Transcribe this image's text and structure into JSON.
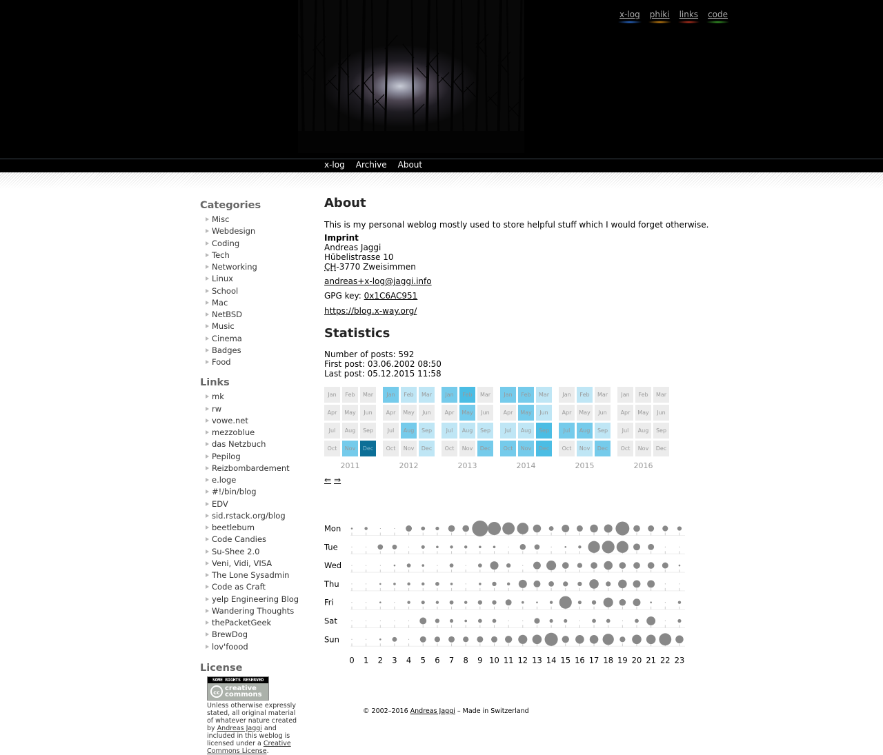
{
  "top_nav": [
    {
      "label": "x-log",
      "color": "#2b6fd6"
    },
    {
      "label": "phiki",
      "color": "#d78a12"
    },
    {
      "label": "links",
      "color": "#c23420"
    },
    {
      "label": "code",
      "color": "#3aa12a"
    }
  ],
  "main_nav": [
    "x-log",
    "Archive",
    "About"
  ],
  "sidebar": {
    "categories_title": "Categories",
    "categories": [
      "Misc",
      "Webdesign",
      "Coding",
      "Tech",
      "Networking",
      "Linux",
      "School",
      "Mac",
      "NetBSD",
      "Music",
      "Cinema",
      "Badges",
      "Food"
    ],
    "links_title": "Links",
    "links": [
      "mk",
      "rw",
      "vowe.net",
      "mezzoblue",
      "das Netzbuch",
      "Pepilog",
      "Reizbombardement",
      "e.loge",
      "#!/bin/blog",
      "EDV",
      "sid.rstack.org/blog",
      "beetlebum",
      "Code Candies",
      "Su-Shee 2.0",
      "Veni, Vidi, VISA",
      "The Lone Sysadmin",
      "Code as Craft",
      "yelp Engineering Blog",
      "Wandering Thoughts",
      "thePacketGeek",
      "BrewDog",
      "lov'foood"
    ],
    "license_title": "License",
    "license_badge_top": "SOME RIGHTS RESERVED",
    "license_badge_word1": "creative",
    "license_badge_word2": "commons",
    "license_text_1": "Unless otherwise expressly stated, all original material of whatever nature created by ",
    "license_author": "Andreas Jaggi",
    "license_text_2": " and included in this weblog is licensed under a ",
    "license_link": "Creative Commons License",
    "license_text_3": "."
  },
  "about": {
    "title": "About",
    "intro": "This is my personal weblog mostly used to store helpful stuff which I would forget otherwise.",
    "imprint_label": "Imprint",
    "name": "Andreas Jaggi",
    "street": "Hübelistrasse 10",
    "country": "CH",
    "city": "-3770 Zweisimmen",
    "email": "andreas+x-log@jaggi.info",
    "gpg_label": "GPG key: ",
    "gpg_key": "0x1C6AC951",
    "url": "https://blog.x-way.org/"
  },
  "statistics": {
    "title": "Statistics",
    "posts": "Number of posts: 592",
    "first": "First post: 03.06.2002 08:50",
    "last": "Last post: 05.12.2015 11:58"
  },
  "calendar": {
    "months": [
      "Jan",
      "Feb",
      "Mar",
      "Apr",
      "May",
      "Jun",
      "Jul",
      "Aug",
      "Sep",
      "Oct",
      "Nov",
      "Dec"
    ],
    "years": [
      {
        "year": "2011",
        "levels": [
          0,
          0,
          0,
          0,
          0,
          0,
          0,
          0,
          0,
          0,
          3,
          6
        ]
      },
      {
        "year": "2012",
        "levels": [
          3,
          1,
          1,
          0,
          0,
          0,
          0,
          3,
          1,
          0,
          0,
          1
        ]
      },
      {
        "year": "2013",
        "levels": [
          3,
          4,
          0,
          0,
          3,
          0,
          1,
          1,
          1,
          0,
          0,
          3
        ]
      },
      {
        "year": "2014",
        "levels": [
          3,
          3,
          1,
          0,
          3,
          1,
          1,
          1,
          4,
          3,
          3,
          4
        ]
      },
      {
        "year": "2015",
        "levels": [
          0,
          1,
          0,
          0,
          0,
          0,
          3,
          3,
          1,
          0,
          1,
          3
        ]
      },
      {
        "year": "2016",
        "levels": [
          0,
          0,
          0,
          0,
          0,
          0,
          0,
          0,
          0,
          0,
          0,
          0
        ]
      }
    ],
    "level_colors": [
      "#ececec",
      "#bfe6f5",
      "#a6dcf2",
      "#75cbeb",
      "#4bbde4",
      "#2aa8d8",
      "#0c6f97"
    ],
    "prev": "⇐",
    "next": "⇒"
  },
  "punchcard": {
    "days": [
      "Mon",
      "Tue",
      "Wed",
      "Thu",
      "Fri",
      "Sat",
      "Sun"
    ],
    "hours": [
      "0",
      "1",
      "2",
      "3",
      "4",
      "5",
      "6",
      "7",
      "8",
      "9",
      "10",
      "11",
      "12",
      "13",
      "14",
      "15",
      "16",
      "17",
      "18",
      "19",
      "20",
      "21",
      "22",
      "23"
    ],
    "counts": [
      [
        1,
        3,
        0,
        0,
        12,
        5,
        4,
        14,
        14,
        80,
        55,
        48,
        42,
        20,
        7,
        18,
        12,
        20,
        22,
        60,
        14,
        12,
        10,
        6
      ],
      [
        0,
        0,
        9,
        7,
        0,
        4,
        2,
        3,
        3,
        2,
        2,
        0,
        11,
        9,
        0,
        1,
        3,
        45,
        50,
        45,
        15,
        12,
        0,
        0
      ],
      [
        0,
        0,
        0,
        1,
        5,
        2,
        0,
        5,
        0,
        5,
        22,
        6,
        0,
        18,
        30,
        14,
        8,
        14,
        24,
        14,
        14,
        14,
        12,
        1
      ],
      [
        0,
        0,
        1,
        2,
        3,
        3,
        5,
        2,
        0,
        2,
        6,
        3,
        22,
        15,
        9,
        8,
        6,
        28,
        8,
        24,
        18,
        18,
        0,
        0
      ],
      [
        0,
        0,
        1,
        0,
        3,
        4,
        3,
        5,
        3,
        6,
        6,
        12,
        2,
        1,
        3,
        50,
        4,
        6,
        30,
        14,
        18,
        1,
        0,
        3
      ],
      [
        0,
        0,
        0,
        0,
        0,
        15,
        6,
        4,
        2,
        5,
        5,
        0,
        0,
        10,
        4,
        4,
        0,
        5,
        5,
        0,
        5,
        25,
        0,
        4
      ],
      [
        0,
        0,
        1,
        7,
        0,
        12,
        10,
        12,
        10,
        12,
        12,
        16,
        26,
        28,
        55,
        16,
        24,
        24,
        40,
        10,
        28,
        28,
        48,
        20
      ]
    ],
    "dot_color": "#888888"
  },
  "footer": {
    "prefix": "© 2002–2016 ",
    "author": "Andreas Jaggi",
    "suffix": " – Made in Switzerland"
  }
}
